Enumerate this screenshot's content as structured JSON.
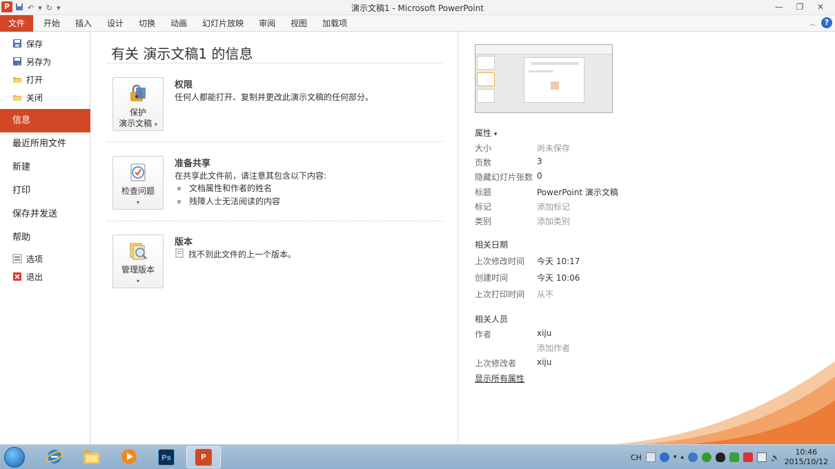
{
  "window": {
    "title": "演示文稿1 - Microsoft PowerPoint",
    "app_logo": "P"
  },
  "ribbon": {
    "file_tab": "文件",
    "tabs": [
      "开始",
      "插入",
      "设计",
      "切换",
      "动画",
      "幻灯片放映",
      "审阅",
      "视图",
      "加载项"
    ]
  },
  "nav": {
    "save": "保存",
    "save_as": "另存为",
    "open": "打开",
    "close": "关闭",
    "info": "信息",
    "recent": "最近所用文件",
    "new": "新建",
    "print": "打印",
    "save_send": "保存并发送",
    "help": "帮助",
    "options": "选项",
    "exit": "退出"
  },
  "main": {
    "title": "有关 演示文稿1 的信息",
    "permissions": {
      "button_line1": "保护",
      "button_line2": "演示文稿",
      "heading": "权限",
      "description": "任何人都能打开、复制并更改此演示文稿的任何部分。"
    },
    "prepare": {
      "button_label": "检查问题",
      "heading": "准备共享",
      "description": "在共享此文件前，请注意其包含以下内容:",
      "bullets": [
        "文档属性和作者的姓名",
        "残障人士无法阅读的内容"
      ]
    },
    "versions": {
      "button_label": "管理版本",
      "heading": "版本",
      "description": "找不到此文件的上一个版本。"
    }
  },
  "properties": {
    "header": "属性",
    "rows": [
      {
        "key": "大小",
        "value": "尚未保存"
      },
      {
        "key": "页数",
        "value": "3"
      },
      {
        "key": "隐藏幻灯片张数",
        "value": "0"
      },
      {
        "key": "标题",
        "value": "PowerPoint 演示文稿"
      },
      {
        "key": "标记",
        "value": "添加标记"
      },
      {
        "key": "类别",
        "value": "添加类别"
      }
    ],
    "dates_header": "相关日期",
    "dates": [
      {
        "key": "上次修改时间",
        "value": "今天 10:17"
      },
      {
        "key": "创建时间",
        "value": "今天 10:06"
      },
      {
        "key": "上次打印时间",
        "value": "从不"
      }
    ],
    "people_header": "相关人员",
    "author_key": "作者",
    "author_value": "xiju",
    "add_author": "添加作者",
    "last_modified_by_key": "上次修改者",
    "last_modified_by_value": "xiju",
    "show_all": "显示所有属性"
  },
  "taskbar": {
    "lang": "CH",
    "time": "10:46",
    "date": "2015/10/12",
    "ps_label": "Ps"
  },
  "colors": {
    "accent": "#d24726",
    "nav_active": "#d24726"
  }
}
